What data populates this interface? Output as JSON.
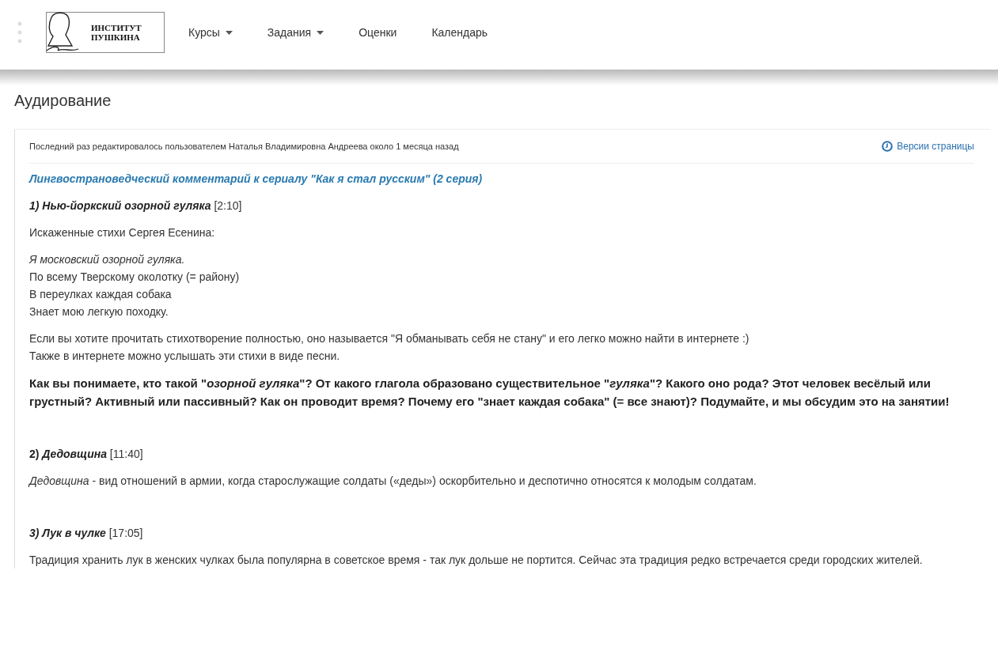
{
  "logo": {
    "line_1": "ИНСТИТУТ",
    "line_2": "ПУШКИНА"
  },
  "nav": [
    {
      "label": "Курсы",
      "dropdown": true
    },
    {
      "label": "Задания",
      "dropdown": true
    },
    {
      "label": "Оценки",
      "dropdown": false
    },
    {
      "label": "Календарь",
      "dropdown": false
    }
  ],
  "page_title": "Аудирование",
  "edit_info": "Последний раз редактировалось пользователем Наталья Владимировна Андреева около 1 месяца назад",
  "versions_link": "Версии страницы",
  "article_title": "Лингвострановедческий комментарий к сериалу \"Как я стал русским\" (2 серия)",
  "blocks": [
    {
      "kind": "heading",
      "title": "*1) Нью-йоркский озорной гуляка*",
      "timecode": "[2:10]"
    },
    {
      "kind": "paragraph",
      "text": "Искаженные стихи Сергея Есенина:"
    },
    {
      "kind": "poem",
      "lines": [
        {
          "text": "Я московский озорной гуляка.",
          "italic": true
        },
        {
          "text": "По всему Тверскому околотку (= району)",
          "italic": false
        },
        {
          "text": "В переулках каждая собака",
          "italic": false
        },
        {
          "text": "Знает мою легкую походку.",
          "italic": false
        }
      ]
    },
    {
      "kind": "paragraph",
      "text": "Если вы хотите прочитать стихотворение полностью, оно называется \"Я обманывать себя не стану\" и его легко можно найти в интернете :)\nТакже в интернете можно услышать эти стихи в виде песни."
    },
    {
      "kind": "question",
      "text": "Как вы понимаете, кто такой \"*озорной гуляка*\"? От какого глагола образовано существительное \"*гуляка*\"? Какого оно рода? Этот человек весёлый или грустный? Активный или пассивный? Как он проводит время? Почему его \"знает каждая собака\" (= все знают)? Подумайте, и мы обсудим это на занятии!"
    },
    {
      "kind": "spacer"
    },
    {
      "kind": "heading",
      "title": "2) *Дедовщина*",
      "timecode": "[11:40]"
    },
    {
      "kind": "paragraph",
      "text": "*Дедовщина* - вид отношений в армии, когда старослужащие солдаты («деды») оскорбительно и деспотично относятся к молодым солдатам."
    },
    {
      "kind": "spacer"
    },
    {
      "kind": "heading",
      "title": "*3) Лук в чулке*",
      "timecode": "[17:05]"
    },
    {
      "kind": "paragraph",
      "text": "Традиция хранить лук в женских чулках была популярна в советское время - так лук дольше не портится. Сейчас эта традиция редко встречается среди городских жителей."
    }
  ]
}
